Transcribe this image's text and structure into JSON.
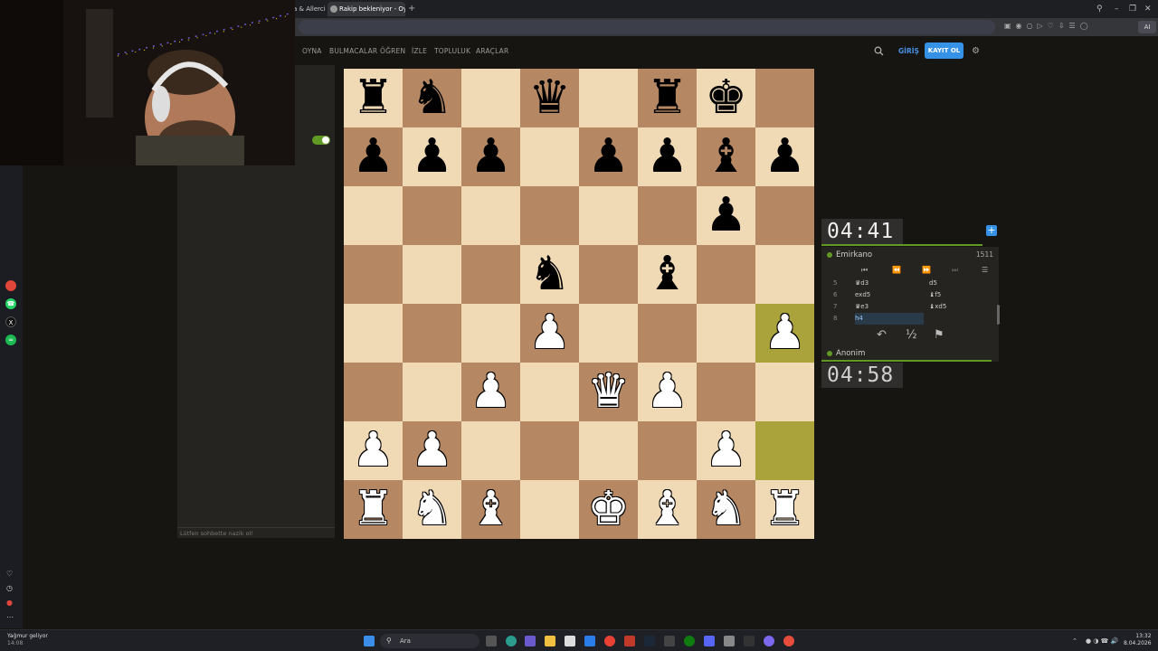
{
  "browser": {
    "tabs": [
      {
        "label": "a & Allerci"
      },
      {
        "label": "Rakip bekleniyor - Oyna l"
      }
    ],
    "new_tab": "+",
    "ai_label": "AI"
  },
  "site": {
    "nav": [
      "OYNA",
      "BULMACALAR",
      "ÖĞREN",
      "İZLE",
      "TOPLULUK",
      "ARAÇLAR"
    ],
    "login": "GİRİŞ",
    "register": "KAYIT OL"
  },
  "chat": {
    "placeholder": "Lütfen sohbette nazik ol!",
    "toggle_on": true
  },
  "board": {
    "highlight": [
      "h4",
      "h2"
    ],
    "pieces": [
      {
        "sq": "a8",
        "p": "♜",
        "c": "b"
      },
      {
        "sq": "b8",
        "p": "♞",
        "c": "b"
      },
      {
        "sq": "d8",
        "p": "♛",
        "c": "b"
      },
      {
        "sq": "f8",
        "p": "♜",
        "c": "b"
      },
      {
        "sq": "g8",
        "p": "♚",
        "c": "b"
      },
      {
        "sq": "a7",
        "p": "♟",
        "c": "b"
      },
      {
        "sq": "b7",
        "p": "♟",
        "c": "b"
      },
      {
        "sq": "c7",
        "p": "♟",
        "c": "b"
      },
      {
        "sq": "e7",
        "p": "♟",
        "c": "b"
      },
      {
        "sq": "f7",
        "p": "♟",
        "c": "b"
      },
      {
        "sq": "g7",
        "p": "♝",
        "c": "b"
      },
      {
        "sq": "h7",
        "p": "♟",
        "c": "b"
      },
      {
        "sq": "g6",
        "p": "♟",
        "c": "b"
      },
      {
        "sq": "d5",
        "p": "♞",
        "c": "b"
      },
      {
        "sq": "f5",
        "p": "♝",
        "c": "b"
      },
      {
        "sq": "d4",
        "p": "♟",
        "c": "w"
      },
      {
        "sq": "h4",
        "p": "♟",
        "c": "w"
      },
      {
        "sq": "c3",
        "p": "♟",
        "c": "w"
      },
      {
        "sq": "e3",
        "p": "♛",
        "c": "w"
      },
      {
        "sq": "f3",
        "p": "♟",
        "c": "w"
      },
      {
        "sq": "a2",
        "p": "♟",
        "c": "w"
      },
      {
        "sq": "b2",
        "p": "♟",
        "c": "w"
      },
      {
        "sq": "g2",
        "p": "♟",
        "c": "w"
      },
      {
        "sq": "a1",
        "p": "♜",
        "c": "w"
      },
      {
        "sq": "b1",
        "p": "♞",
        "c": "w"
      },
      {
        "sq": "c1",
        "p": "♝",
        "c": "w"
      },
      {
        "sq": "e1",
        "p": "♚",
        "c": "w"
      },
      {
        "sq": "f1",
        "p": "♝",
        "c": "w"
      },
      {
        "sq": "g1",
        "p": "♞",
        "c": "w"
      },
      {
        "sq": "h1",
        "p": "♜",
        "c": "w"
      }
    ]
  },
  "game": {
    "opponent": {
      "name": "Emirkano",
      "rating": "1511",
      "clock": "04:41"
    },
    "me": {
      "name": "Anonim",
      "clock": "04:58"
    },
    "moves": [
      {
        "n": "5",
        "w": "♛d3",
        "b": "d5"
      },
      {
        "n": "6",
        "w": "exd5",
        "b": "♝f5"
      },
      {
        "n": "7",
        "w": "♛e3",
        "b": "♝xd5"
      },
      {
        "n": "8",
        "w": "h4",
        "b": ""
      }
    ],
    "draw_label": "½"
  },
  "taskbar": {
    "weather_title": "Yağmur geliyor",
    "weather_sub": "14:08",
    "search": "Ara",
    "time": "13:32",
    "date": "8.04.2026"
  }
}
